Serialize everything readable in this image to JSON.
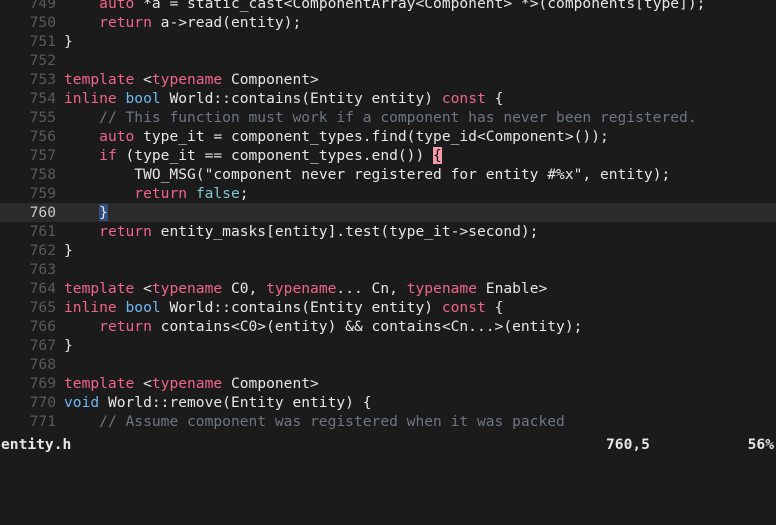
{
  "editor": {
    "lines": [
      {
        "num": "749",
        "segments": [
          {
            "t": "    "
          },
          {
            "t": "auto",
            "c": "kw"
          },
          {
            "t": " *a = static_cast<ComponentArray<Component> *>(components[type]);"
          }
        ]
      },
      {
        "num": "750",
        "segments": [
          {
            "t": "    "
          },
          {
            "t": "return",
            "c": "kw"
          },
          {
            "t": " a->read(entity);"
          }
        ]
      },
      {
        "num": "751",
        "segments": [
          {
            "t": "}"
          }
        ]
      },
      {
        "num": "752",
        "segments": []
      },
      {
        "num": "753",
        "segments": [
          {
            "t": "template",
            "c": "kw"
          },
          {
            "t": " <"
          },
          {
            "t": "typename",
            "c": "kw"
          },
          {
            "t": " Component>"
          }
        ]
      },
      {
        "num": "754",
        "segments": [
          {
            "t": "inline",
            "c": "kw"
          },
          {
            "t": " "
          },
          {
            "t": "bool",
            "c": "ty"
          },
          {
            "t": " World::contains(Entity entity) "
          },
          {
            "t": "const",
            "c": "kw"
          },
          {
            "t": " {"
          }
        ]
      },
      {
        "num": "755",
        "segments": [
          {
            "t": "    "
          },
          {
            "t": "// This function must work if a component has never been registered.",
            "c": "cm"
          }
        ]
      },
      {
        "num": "756",
        "segments": [
          {
            "t": "    "
          },
          {
            "t": "auto",
            "c": "kw"
          },
          {
            "t": " type_it = component_types.find(type_id<Component>());"
          }
        ]
      },
      {
        "num": "757",
        "segments": [
          {
            "t": "    "
          },
          {
            "t": "if",
            "c": "kw"
          },
          {
            "t": " (type_it == component_types.end()) "
          },
          {
            "t": "{",
            "c": "mp-open"
          }
        ]
      },
      {
        "num": "758",
        "segments": [
          {
            "t": "        TWO_MSG("
          },
          {
            "t": "\"component never registered for entity #%x\"",
            "c": "str"
          },
          {
            "t": ", entity);"
          }
        ]
      },
      {
        "num": "759",
        "segments": [
          {
            "t": "        "
          },
          {
            "t": "return",
            "c": "kw"
          },
          {
            "t": " "
          },
          {
            "t": "false",
            "c": "bool"
          },
          {
            "t": ";"
          }
        ]
      },
      {
        "num": "760",
        "cursor": true,
        "segments": [
          {
            "t": "    "
          },
          {
            "t": "}",
            "c": "mp-close"
          }
        ]
      },
      {
        "num": "761",
        "segments": [
          {
            "t": "    "
          },
          {
            "t": "return",
            "c": "kw"
          },
          {
            "t": " entity_masks[entity].test(type_it->second);"
          }
        ]
      },
      {
        "num": "762",
        "segments": [
          {
            "t": "}"
          }
        ]
      },
      {
        "num": "763",
        "segments": []
      },
      {
        "num": "764",
        "segments": [
          {
            "t": "template",
            "c": "kw"
          },
          {
            "t": " <"
          },
          {
            "t": "typename",
            "c": "kw"
          },
          {
            "t": " C0, "
          },
          {
            "t": "typename",
            "c": "kw"
          },
          {
            "t": "... Cn, "
          },
          {
            "t": "typename",
            "c": "kw"
          },
          {
            "t": " Enable>"
          }
        ]
      },
      {
        "num": "765",
        "segments": [
          {
            "t": "inline",
            "c": "kw"
          },
          {
            "t": " "
          },
          {
            "t": "bool",
            "c": "ty"
          },
          {
            "t": " World::contains(Entity entity) "
          },
          {
            "t": "const",
            "c": "kw"
          },
          {
            "t": " {"
          }
        ]
      },
      {
        "num": "766",
        "segments": [
          {
            "t": "    "
          },
          {
            "t": "return",
            "c": "kw"
          },
          {
            "t": " contains<C0>(entity) && contains<Cn...>(entity);"
          }
        ]
      },
      {
        "num": "767",
        "segments": [
          {
            "t": "}"
          }
        ]
      },
      {
        "num": "768",
        "segments": []
      },
      {
        "num": "769",
        "segments": [
          {
            "t": "template",
            "c": "kw"
          },
          {
            "t": " <"
          },
          {
            "t": "typename",
            "c": "kw"
          },
          {
            "t": " Component>"
          }
        ]
      },
      {
        "num": "770",
        "segments": [
          {
            "t": "void",
            "c": "ty"
          },
          {
            "t": " World::remove(Entity entity) {"
          }
        ]
      },
      {
        "num": "771",
        "segments": [
          {
            "t": "    "
          },
          {
            "t": "// Assume component was registered when it was packed",
            "c": "cm"
          }
        ]
      }
    ]
  },
  "statusbar": {
    "filename": "entity.h",
    "position": "760,5",
    "percent": "56%"
  }
}
